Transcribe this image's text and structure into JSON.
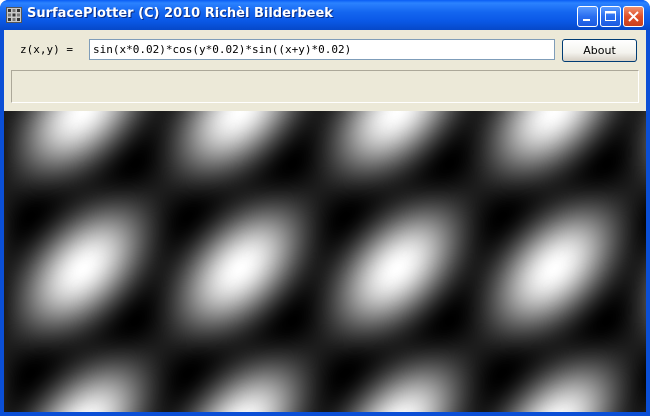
{
  "window": {
    "title": "SurfacePlotter (C) 2010 Richèl Bilderbeek",
    "icon": "app-grid-icon",
    "controls": [
      "minimize-icon",
      "maximize-icon",
      "close-icon"
    ]
  },
  "toolbar": {
    "z_label": "z(x,y) =",
    "formula_value": "sin(x*0.02)*cos(y*0.02)*sin((x+y)*0.02)",
    "about_label": "About"
  },
  "plot": {
    "function": "sin(x*0.02)*cos(y*0.02)*sin((x+y)*0.02)",
    "colormap": "grayscale"
  },
  "colors": {
    "titlebar": "#0a5df5",
    "client_bg": "#ece9d8",
    "close_button": "#e0502a"
  }
}
